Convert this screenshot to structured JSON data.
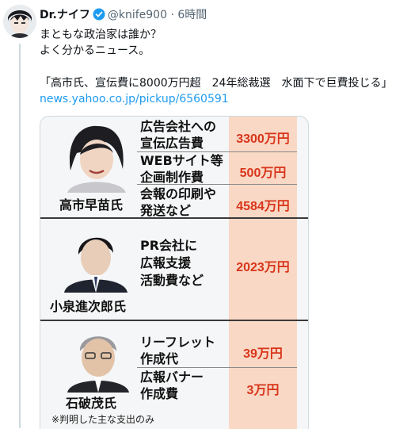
{
  "tweet": {
    "display_name": "Dr.ナイフ",
    "handle": "@knife900",
    "separator": "·",
    "time": "6時間",
    "body": "まともな政治家は誰か？\nよく分かるニュース。",
    "quote": "「高市氏、宣伝費に8000万円超　24年総裁選　水面下で巨費投じる」",
    "link": "news.yahoo.co.jp/pickup/6560591"
  },
  "image": {
    "people": [
      {
        "name": "高市早苗氏",
        "items": [
          {
            "label": "広告会社への\n宣伝広告費",
            "amount": "3300万円"
          },
          {
            "label": "WEBサイト等\n企画制作費",
            "amount": "500万円"
          },
          {
            "label": "会報の印刷や\n発送など",
            "amount": "4584万円"
          }
        ]
      },
      {
        "name": "小泉進次郎氏",
        "items": [
          {
            "label": "PR会社に\n広報支援\n活動費など",
            "amount": "2023万円"
          }
        ]
      },
      {
        "name": "石破茂氏",
        "items": [
          {
            "label": "リーフレット\n作成代",
            "amount": "39万円"
          },
          {
            "label": "広報バナー\n作成費",
            "amount": "3万円"
          }
        ]
      }
    ],
    "footnote": "※判明した主な支出のみ"
  },
  "colors": {
    "link": "#1d9bf0",
    "verified": "#1d9bf0",
    "amount_text": "#d8351a",
    "amount_column": "#f9d8c5"
  }
}
